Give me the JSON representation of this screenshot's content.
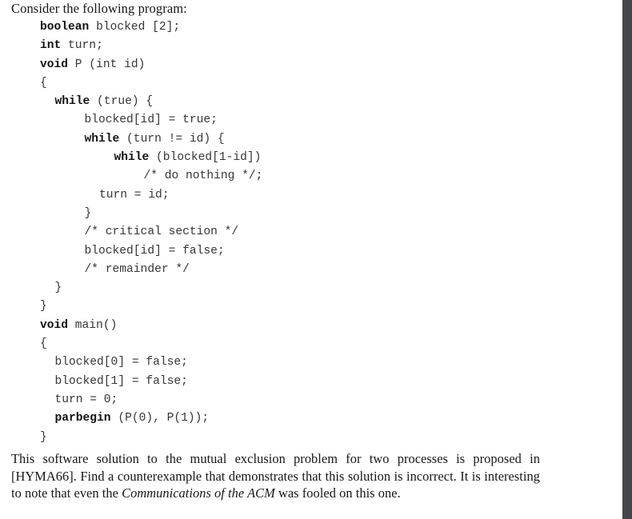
{
  "document": {
    "intro_text": "Consider the following program:",
    "code": {
      "language": "pseudo-c",
      "lines": [
        {
          "indent": 0,
          "bold": "boolean",
          "rest": " blocked [2];"
        },
        {
          "indent": 0,
          "bold": "int",
          "rest": " turn;"
        },
        {
          "indent": 0,
          "bold": "void",
          "rest": " P (int id)"
        },
        {
          "indent": 0,
          "bold": "",
          "rest": "{"
        },
        {
          "indent": 1,
          "bold": "while",
          "rest": " (true) {"
        },
        {
          "indent": 3,
          "bold": "",
          "rest": "blocked[id] = true;"
        },
        {
          "indent": 3,
          "bold": "while",
          "rest": " (turn != id) {"
        },
        {
          "indent": 5,
          "bold": "while",
          "rest": " (blocked[1-id])"
        },
        {
          "indent": 7,
          "bold": "",
          "rest": "/* do nothing */;"
        },
        {
          "indent": 4,
          "bold": "",
          "rest": "turn = id;"
        },
        {
          "indent": 3,
          "bold": "",
          "rest": "}"
        },
        {
          "indent": 3,
          "bold": "",
          "rest": "/* critical section */"
        },
        {
          "indent": 3,
          "bold": "",
          "rest": "blocked[id] = false;"
        },
        {
          "indent": 3,
          "bold": "",
          "rest": "/* remainder */"
        },
        {
          "indent": 1,
          "bold": "",
          "rest": "}"
        },
        {
          "indent": 0,
          "bold": "",
          "rest": "}"
        },
        {
          "indent": 0,
          "bold": "void",
          "rest": " main()"
        },
        {
          "indent": 0,
          "bold": "",
          "rest": "{"
        },
        {
          "indent": 1,
          "bold": "",
          "rest": "blocked[0] = false;"
        },
        {
          "indent": 1,
          "bold": "",
          "rest": "blocked[1] = false;"
        },
        {
          "indent": 1,
          "bold": "",
          "rest": "turn = 0;"
        },
        {
          "indent": 1,
          "bold": "parbegin",
          "rest": " (P(0), P(1));"
        },
        {
          "indent": 0,
          "bold": "",
          "rest": "}"
        }
      ]
    },
    "paragraph": {
      "segment_1": "This software solution to the mutual exclusion problem for two processes is proposed in [HYMA66]. Find a counterexample that demonstrates that this solution is incorrect. It is interesting to note that even the ",
      "italic_title": "Communications of the ACM",
      "segment_2": " was fooled on this one.",
      "citation": "[HYMA66]"
    },
    "colors": {
      "page_background": "#ffffff",
      "body_text": "#16161e",
      "code_text": "#35353d",
      "code_keyword": "#111118",
      "right_bar": "#43474c"
    },
    "right_bar": {
      "name": "scrollbar"
    }
  }
}
